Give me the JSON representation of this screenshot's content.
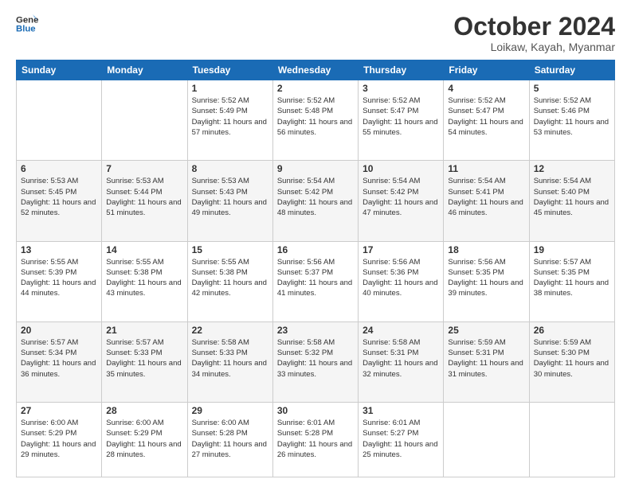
{
  "logo": {
    "line1": "General",
    "line2": "Blue"
  },
  "title": "October 2024",
  "location": "Loikaw, Kayah, Myanmar",
  "weekdays": [
    "Sunday",
    "Monday",
    "Tuesday",
    "Wednesday",
    "Thursday",
    "Friday",
    "Saturday"
  ],
  "weeks": [
    [
      {
        "day": "",
        "sunrise": "",
        "sunset": "",
        "daylight": "",
        "empty": true
      },
      {
        "day": "",
        "sunrise": "",
        "sunset": "",
        "daylight": "",
        "empty": true
      },
      {
        "day": "1",
        "sunrise": "Sunrise: 5:52 AM",
        "sunset": "Sunset: 5:49 PM",
        "daylight": "Daylight: 11 hours and 57 minutes."
      },
      {
        "day": "2",
        "sunrise": "Sunrise: 5:52 AM",
        "sunset": "Sunset: 5:48 PM",
        "daylight": "Daylight: 11 hours and 56 minutes."
      },
      {
        "day": "3",
        "sunrise": "Sunrise: 5:52 AM",
        "sunset": "Sunset: 5:47 PM",
        "daylight": "Daylight: 11 hours and 55 minutes."
      },
      {
        "day": "4",
        "sunrise": "Sunrise: 5:52 AM",
        "sunset": "Sunset: 5:47 PM",
        "daylight": "Daylight: 11 hours and 54 minutes."
      },
      {
        "day": "5",
        "sunrise": "Sunrise: 5:52 AM",
        "sunset": "Sunset: 5:46 PM",
        "daylight": "Daylight: 11 hours and 53 minutes."
      }
    ],
    [
      {
        "day": "6",
        "sunrise": "Sunrise: 5:53 AM",
        "sunset": "Sunset: 5:45 PM",
        "daylight": "Daylight: 11 hours and 52 minutes."
      },
      {
        "day": "7",
        "sunrise": "Sunrise: 5:53 AM",
        "sunset": "Sunset: 5:44 PM",
        "daylight": "Daylight: 11 hours and 51 minutes."
      },
      {
        "day": "8",
        "sunrise": "Sunrise: 5:53 AM",
        "sunset": "Sunset: 5:43 PM",
        "daylight": "Daylight: 11 hours and 49 minutes."
      },
      {
        "day": "9",
        "sunrise": "Sunrise: 5:54 AM",
        "sunset": "Sunset: 5:42 PM",
        "daylight": "Daylight: 11 hours and 48 minutes."
      },
      {
        "day": "10",
        "sunrise": "Sunrise: 5:54 AM",
        "sunset": "Sunset: 5:42 PM",
        "daylight": "Daylight: 11 hours and 47 minutes."
      },
      {
        "day": "11",
        "sunrise": "Sunrise: 5:54 AM",
        "sunset": "Sunset: 5:41 PM",
        "daylight": "Daylight: 11 hours and 46 minutes."
      },
      {
        "day": "12",
        "sunrise": "Sunrise: 5:54 AM",
        "sunset": "Sunset: 5:40 PM",
        "daylight": "Daylight: 11 hours and 45 minutes."
      }
    ],
    [
      {
        "day": "13",
        "sunrise": "Sunrise: 5:55 AM",
        "sunset": "Sunset: 5:39 PM",
        "daylight": "Daylight: 11 hours and 44 minutes."
      },
      {
        "day": "14",
        "sunrise": "Sunrise: 5:55 AM",
        "sunset": "Sunset: 5:38 PM",
        "daylight": "Daylight: 11 hours and 43 minutes."
      },
      {
        "day": "15",
        "sunrise": "Sunrise: 5:55 AM",
        "sunset": "Sunset: 5:38 PM",
        "daylight": "Daylight: 11 hours and 42 minutes."
      },
      {
        "day": "16",
        "sunrise": "Sunrise: 5:56 AM",
        "sunset": "Sunset: 5:37 PM",
        "daylight": "Daylight: 11 hours and 41 minutes."
      },
      {
        "day": "17",
        "sunrise": "Sunrise: 5:56 AM",
        "sunset": "Sunset: 5:36 PM",
        "daylight": "Daylight: 11 hours and 40 minutes."
      },
      {
        "day": "18",
        "sunrise": "Sunrise: 5:56 AM",
        "sunset": "Sunset: 5:35 PM",
        "daylight": "Daylight: 11 hours and 39 minutes."
      },
      {
        "day": "19",
        "sunrise": "Sunrise: 5:57 AM",
        "sunset": "Sunset: 5:35 PM",
        "daylight": "Daylight: 11 hours and 38 minutes."
      }
    ],
    [
      {
        "day": "20",
        "sunrise": "Sunrise: 5:57 AM",
        "sunset": "Sunset: 5:34 PM",
        "daylight": "Daylight: 11 hours and 36 minutes."
      },
      {
        "day": "21",
        "sunrise": "Sunrise: 5:57 AM",
        "sunset": "Sunset: 5:33 PM",
        "daylight": "Daylight: 11 hours and 35 minutes."
      },
      {
        "day": "22",
        "sunrise": "Sunrise: 5:58 AM",
        "sunset": "Sunset: 5:33 PM",
        "daylight": "Daylight: 11 hours and 34 minutes."
      },
      {
        "day": "23",
        "sunrise": "Sunrise: 5:58 AM",
        "sunset": "Sunset: 5:32 PM",
        "daylight": "Daylight: 11 hours and 33 minutes."
      },
      {
        "day": "24",
        "sunrise": "Sunrise: 5:58 AM",
        "sunset": "Sunset: 5:31 PM",
        "daylight": "Daylight: 11 hours and 32 minutes."
      },
      {
        "day": "25",
        "sunrise": "Sunrise: 5:59 AM",
        "sunset": "Sunset: 5:31 PM",
        "daylight": "Daylight: 11 hours and 31 minutes."
      },
      {
        "day": "26",
        "sunrise": "Sunrise: 5:59 AM",
        "sunset": "Sunset: 5:30 PM",
        "daylight": "Daylight: 11 hours and 30 minutes."
      }
    ],
    [
      {
        "day": "27",
        "sunrise": "Sunrise: 6:00 AM",
        "sunset": "Sunset: 5:29 PM",
        "daylight": "Daylight: 11 hours and 29 minutes."
      },
      {
        "day": "28",
        "sunrise": "Sunrise: 6:00 AM",
        "sunset": "Sunset: 5:29 PM",
        "daylight": "Daylight: 11 hours and 28 minutes."
      },
      {
        "day": "29",
        "sunrise": "Sunrise: 6:00 AM",
        "sunset": "Sunset: 5:28 PM",
        "daylight": "Daylight: 11 hours and 27 minutes."
      },
      {
        "day": "30",
        "sunrise": "Sunrise: 6:01 AM",
        "sunset": "Sunset: 5:28 PM",
        "daylight": "Daylight: 11 hours and 26 minutes."
      },
      {
        "day": "31",
        "sunrise": "Sunrise: 6:01 AM",
        "sunset": "Sunset: 5:27 PM",
        "daylight": "Daylight: 11 hours and 25 minutes."
      },
      {
        "day": "",
        "sunrise": "",
        "sunset": "",
        "daylight": "",
        "empty": true
      },
      {
        "day": "",
        "sunrise": "",
        "sunset": "",
        "daylight": "",
        "empty": true
      }
    ]
  ]
}
